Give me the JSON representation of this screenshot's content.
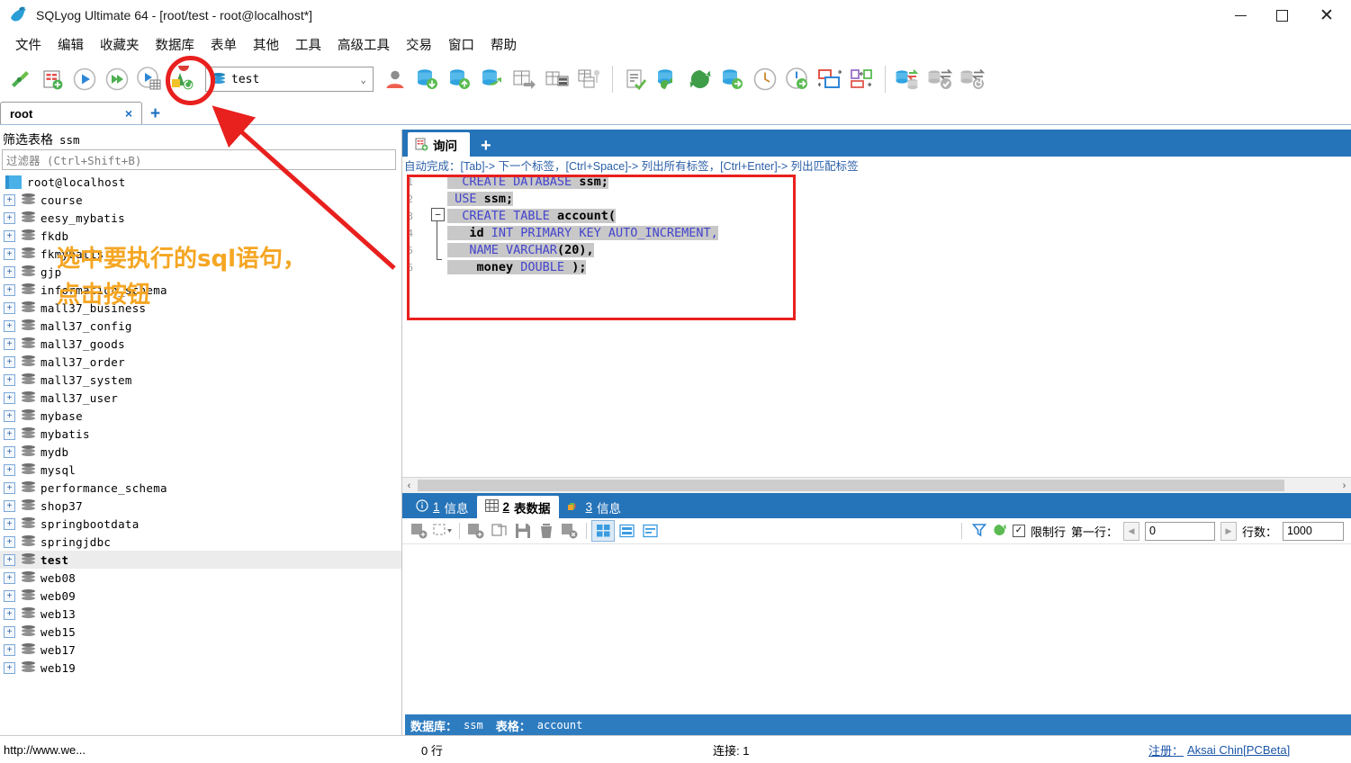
{
  "window": {
    "title": "SQLyog Ultimate 64 - [root/test - root@localhost*]",
    "app_icon": "sqlyog-dolphin-icon",
    "minimize": "minimize-icon",
    "maximize": "maximize-icon",
    "close": "close-icon"
  },
  "menubar": {
    "items": [
      {
        "label": "文件"
      },
      {
        "label": "编辑"
      },
      {
        "label": "收藏夹"
      },
      {
        "label": "数据库"
      },
      {
        "label": "表单"
      },
      {
        "label": "其他"
      },
      {
        "label": "工具"
      },
      {
        "label": "高级工具"
      },
      {
        "label": "交易"
      },
      {
        "label": "窗口"
      },
      {
        "label": "帮助"
      }
    ]
  },
  "toolbar": {
    "database_selector_value": "test",
    "buttons": [
      {
        "name": "new-connection-icon"
      },
      {
        "name": "new-query-tab-icon"
      },
      {
        "name": "execute-query-icon"
      },
      {
        "name": "execute-all-queries-icon"
      },
      {
        "name": "execute-query-and-show-grid-icon"
      },
      {
        "name": "refresh-objects-icon"
      },
      {
        "name": "user-manager-icon"
      },
      {
        "name": "import-database-icon"
      },
      {
        "name": "export-database-icon"
      },
      {
        "name": "sync-database-icon"
      },
      {
        "name": "table-data-export-icon"
      },
      {
        "name": "table-diagnostics-icon"
      },
      {
        "name": "schema-designer-icon"
      },
      {
        "name": "query-builder-icon"
      },
      {
        "name": "backup-database-icon"
      },
      {
        "name": "restore-database-icon"
      },
      {
        "name": "copy-database-icon"
      },
      {
        "name": "scheduler-icon"
      },
      {
        "name": "job-agent-icon"
      },
      {
        "name": "form-view-icon"
      },
      {
        "name": "object-browser-icon"
      },
      {
        "name": "data-sync-icon"
      },
      {
        "name": "schema-sync-check-icon"
      },
      {
        "name": "schema-sync-revert-icon"
      }
    ]
  },
  "connection_tabs": {
    "tabs": [
      {
        "label": "root",
        "close": "×"
      }
    ],
    "add_label": "+"
  },
  "object_browser": {
    "filter_title": "筛选表格",
    "filter_db": "ssm",
    "filter_placeholder": "过滤器 (Ctrl+Shift+B)",
    "root_label": "root@localhost",
    "databases": [
      "course",
      "eesy_mybatis",
      "fkdb",
      "fkmybatis",
      "gjp",
      "information_schema",
      "mall37_business",
      "mall37_config",
      "mall37_goods",
      "mall37_order",
      "mall37_system",
      "mall37_user",
      "mybase",
      "mybatis",
      "mydb",
      "mysql",
      "performance_schema",
      "shop37",
      "springbootdata",
      "springjdbc",
      "test",
      "web08",
      "web09",
      "web13",
      "web15",
      "web17",
      "web19"
    ],
    "selected_database": "test",
    "expander_symbol": "+"
  },
  "query_panel": {
    "tab_label": "询问",
    "add_label": "+",
    "hint": "自动完成：[Tab]-> 下一个标签，[Ctrl+Space]-> 列出所有标签，[Ctrl+Enter]-> 列出匹配标签",
    "line_numbers": [
      "1",
      "2",
      "3",
      "4",
      "5",
      "6"
    ],
    "fold_symbol": "−",
    "sql_lines": [
      [
        {
          "t": "  ",
          "c": "pl"
        },
        {
          "t": "CREATE DATABASE ",
          "c": "kw"
        },
        {
          "t": "ssm;",
          "c": "idn"
        }
      ],
      [
        {
          "t": " ",
          "c": "pl"
        },
        {
          "t": "USE ",
          "c": "kw"
        },
        {
          "t": "ssm;",
          "c": "idn"
        }
      ],
      [
        {
          "t": "  ",
          "c": "pl"
        },
        {
          "t": "CREATE TABLE ",
          "c": "kw"
        },
        {
          "t": "account(",
          "c": "idn"
        }
      ],
      [
        {
          "t": "   ",
          "c": "pl"
        },
        {
          "t": "id ",
          "c": "idn"
        },
        {
          "t": "INT PRIMARY KEY AUTO_INCREMENT,",
          "c": "kw"
        }
      ],
      [
        {
          "t": "   ",
          "c": "pl"
        },
        {
          "t": "NAME VARCHAR",
          "c": "kw"
        },
        {
          "t": "(20),",
          "c": "idn"
        }
      ],
      [
        {
          "t": "    ",
          "c": "pl"
        },
        {
          "t": "money ",
          "c": "idn"
        },
        {
          "t": "DOUBLE ",
          "c": "kw"
        },
        {
          "t": ");",
          "c": "idn"
        }
      ]
    ],
    "scroll_left_arrow": "‹",
    "scroll_right_arrow": "›"
  },
  "results": {
    "tabs": [
      {
        "num": "1",
        "label": "信息",
        "icon": "info-circle-icon",
        "active": false
      },
      {
        "num": "2",
        "label": "表数据",
        "icon": "table-grid-icon",
        "active": true
      },
      {
        "num": "3",
        "label": "信息",
        "icon": "chart-icon",
        "active": false
      }
    ],
    "toolbar_buttons": [
      {
        "name": "refresh-data-icon"
      },
      {
        "name": "column-chooser-icon"
      },
      {
        "name": "insert-row-icon"
      },
      {
        "name": "duplicate-row-icon"
      },
      {
        "name": "save-changes-icon"
      },
      {
        "name": "delete-row-icon"
      },
      {
        "name": "cancel-changes-icon"
      },
      {
        "name": "grid-view-icon"
      },
      {
        "name": "form-view-icon"
      },
      {
        "name": "text-view-icon"
      }
    ],
    "filter_icon": "filter-icon",
    "refresh_icon": "refresh-icon",
    "limit_checkbox_label": "限制行",
    "limit_checked": true,
    "first_row_label": "第一行：",
    "first_row_value": "0",
    "rows_label": "行数：",
    "rows_value": "1000",
    "prev_arrow": "◀",
    "next_arrow": "▶",
    "status_db_key": "数据库：",
    "status_db_value": "ssm",
    "status_table_key": "表格：",
    "status_table_value": "account"
  },
  "statusbar": {
    "url": "http://www.we...",
    "rows": "0 行",
    "connections": "连接: 1",
    "register_label": "注册：",
    "register_value": "Aksai Chin[PCBeta]"
  },
  "annotations": {
    "line1": "选中要执行的sql语句，",
    "line2": "点击按钮",
    "highlight_color": "#e8201e",
    "text_color": "#f5a623"
  }
}
